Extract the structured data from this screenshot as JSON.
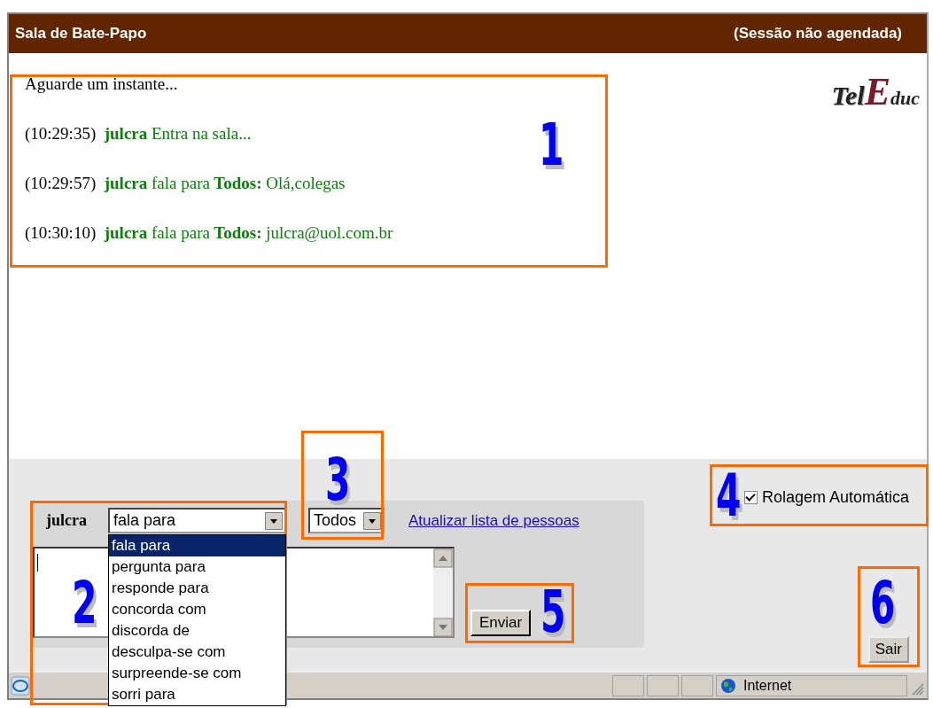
{
  "window": {
    "title": "Sala de Bate-Papo",
    "session": "(Sessão não agendada)"
  },
  "logo": {
    "part_1": "Tel",
    "part_2": "E",
    "part_3": "duc"
  },
  "chat": {
    "notice": "Aguarde um instante...",
    "messages": [
      {
        "time": "(10:29:35)",
        "user": "julcra",
        "action": "Entra na sala..."
      },
      {
        "time": "(10:29:57)",
        "user": "julcra",
        "action": "fala para",
        "target": "Todos:",
        "text": "Olá,colegas"
      },
      {
        "time": "(10:30:10)",
        "user": "julcra",
        "action": "fala para",
        "target": "Todos:",
        "text": "julcra@uol.com.br"
      }
    ]
  },
  "form": {
    "user": "julcra",
    "verb_select": {
      "value": "fala para",
      "expanded": true,
      "options": [
        {
          "label": "fala para",
          "selected": true
        },
        {
          "label": "pergunta para",
          "selected": false
        },
        {
          "label": "responde para",
          "selected": false
        },
        {
          "label": "concorda com",
          "selected": false
        },
        {
          "label": "discorda de",
          "selected": false
        },
        {
          "label": "desculpa-se com",
          "selected": false
        },
        {
          "label": "surpreende-se com",
          "selected": false
        },
        {
          "label": "sorri para",
          "selected": false
        }
      ]
    },
    "recipient_select": {
      "value": "Todos"
    },
    "refresh_link": "Atualizar lista de pessoas",
    "send_button": "Enviar"
  },
  "auto_scroll": {
    "label": "Rolagem Automática",
    "checked": true
  },
  "exit_button": "Sair",
  "status_bar": {
    "zone": "Internet"
  },
  "annotations": [
    {
      "label": "1"
    },
    {
      "label": "2"
    },
    {
      "label": "3"
    },
    {
      "label": "4"
    },
    {
      "label": "5"
    },
    {
      "label": "6"
    }
  ]
}
